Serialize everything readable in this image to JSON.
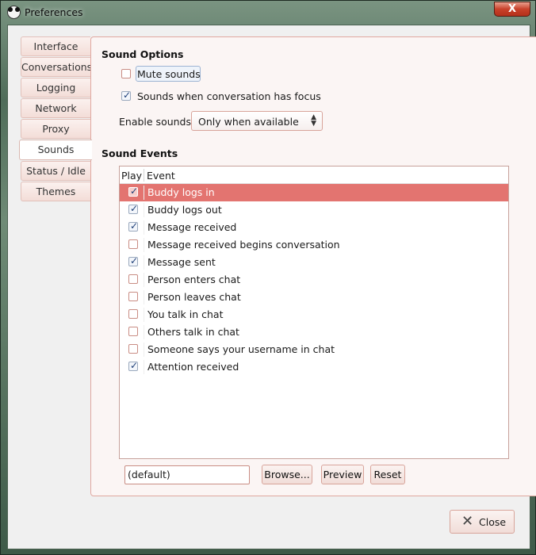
{
  "window": {
    "title": "Preferences",
    "close_glyph": "X"
  },
  "tabs": [
    {
      "label": "Interface"
    },
    {
      "label": "Conversations"
    },
    {
      "label": "Logging"
    },
    {
      "label": "Network"
    },
    {
      "label": "Proxy"
    },
    {
      "label": "Sounds",
      "active": true
    },
    {
      "label": "Status / Idle"
    },
    {
      "label": "Themes"
    }
  ],
  "sound_options": {
    "title": "Sound Options",
    "mute": {
      "label": "Mute sounds",
      "checked": false
    },
    "focus": {
      "label": "Sounds when conversation has focus",
      "checked": true
    },
    "enable_label": "Enable sounds:",
    "enable_value": "Only when available"
  },
  "sound_events": {
    "title": "Sound Events",
    "columns": {
      "play": "Play",
      "event": "Event"
    },
    "rows": [
      {
        "label": "Buddy logs in",
        "checked": true,
        "selected": true
      },
      {
        "label": "Buddy logs out",
        "checked": true
      },
      {
        "label": "Message received",
        "checked": true
      },
      {
        "label": "Message received begins conversation",
        "checked": false
      },
      {
        "label": "Message sent",
        "checked": true
      },
      {
        "label": "Person enters chat",
        "checked": false
      },
      {
        "label": "Person leaves chat",
        "checked": false
      },
      {
        "label": "You talk in chat",
        "checked": false
      },
      {
        "label": "Others talk in chat",
        "checked": false
      },
      {
        "label": "Someone says your username in chat",
        "checked": false
      },
      {
        "label": "Attention received",
        "checked": true
      }
    ],
    "file_value": "(default)",
    "browse_label": "Browse...",
    "preview_label": "Preview",
    "reset_label": "Reset"
  },
  "footer": {
    "close_label": "Close"
  },
  "colors": {
    "selection": "#e37470",
    "panel_border": "#e0a8a0"
  }
}
